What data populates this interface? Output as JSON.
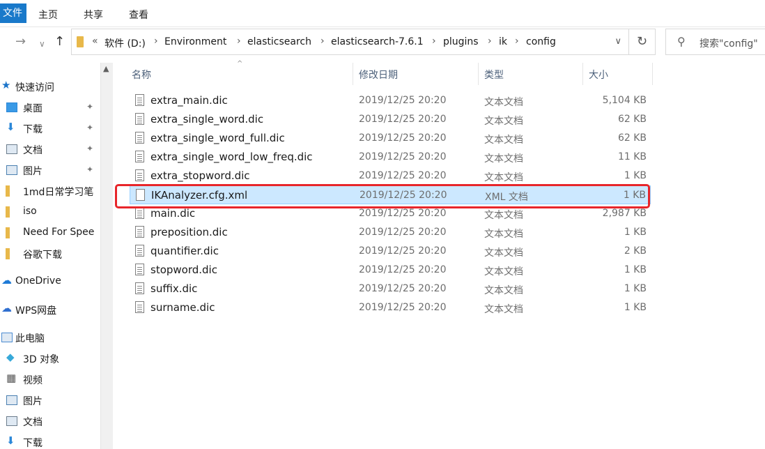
{
  "ribbon": {
    "file": "文件",
    "tabs": [
      "主页",
      "共享",
      "查看"
    ]
  },
  "address": {
    "crumbs": [
      "软件 (D:)",
      "Environment",
      "elasticsearch",
      "elasticsearch-7.6.1",
      "plugins",
      "ik",
      "config"
    ],
    "overflow": "«",
    "search_placeholder": "搜索\"config\""
  },
  "nav_pane": {
    "items": [
      {
        "label": "快速访问",
        "icon": "star-icon",
        "color": "#1a73c9"
      },
      {
        "label": "桌面",
        "icon": "desktop-icon",
        "color": "#2b87d8",
        "pinned": true
      },
      {
        "label": "下载",
        "icon": "download-arrow-icon",
        "color": "#2b87d8",
        "pinned": true
      },
      {
        "label": "文档",
        "icon": "document-icon",
        "color": "#6b7c8c",
        "pinned": true
      },
      {
        "label": "图片",
        "icon": "picture-icon",
        "color": "#4a7fb0",
        "pinned": true
      },
      {
        "label": "1md日常学习笔",
        "icon": "folder-icon",
        "color": "#e8b84a"
      },
      {
        "label": "iso",
        "icon": "folder-icon",
        "color": "#e8b84a"
      },
      {
        "label": "Need For Spee",
        "icon": "folder-icon",
        "color": "#e8b84a"
      },
      {
        "label": "谷歌下载",
        "icon": "folder-icon",
        "color": "#e8b84a"
      },
      {
        "label": "OneDrive",
        "icon": "cloud-icon",
        "color": "#1e7ad6"
      },
      {
        "label": "WPS网盘",
        "icon": "cloud-icon",
        "color": "#2f6fd0"
      },
      {
        "label": "此电脑",
        "icon": "computer-icon",
        "color": "#4b8bd1"
      },
      {
        "label": "3D 对象",
        "icon": "cube-icon",
        "color": "#37a9d9"
      },
      {
        "label": "视频",
        "icon": "film-icon",
        "color": "#555555"
      },
      {
        "label": "图片",
        "icon": "picture-icon",
        "color": "#4a7fb0"
      },
      {
        "label": "文档",
        "icon": "document-icon",
        "color": "#6b7c8c"
      },
      {
        "label": "下载",
        "icon": "download-arrow-icon",
        "color": "#2b87d8"
      }
    ]
  },
  "columns": {
    "name": "名称",
    "modified": "修改日期",
    "type": "类型",
    "size": "大小"
  },
  "files": [
    {
      "name": "extra_main.dic",
      "date": "2019/12/25 20:20",
      "type": "文本文档",
      "size": "5,104 KB"
    },
    {
      "name": "extra_single_word.dic",
      "date": "2019/12/25 20:20",
      "type": "文本文档",
      "size": "62 KB"
    },
    {
      "name": "extra_single_word_full.dic",
      "date": "2019/12/25 20:20",
      "type": "文本文档",
      "size": "62 KB"
    },
    {
      "name": "extra_single_word_low_freq.dic",
      "date": "2019/12/25 20:20",
      "type": "文本文档",
      "size": "11 KB"
    },
    {
      "name": "extra_stopword.dic",
      "date": "2019/12/25 20:20",
      "type": "文本文档",
      "size": "1 KB"
    },
    {
      "name": "IKAnalyzer.cfg.xml",
      "date": "2019/12/25 20:20",
      "type": "XML 文档",
      "size": "1 KB",
      "selected": true
    },
    {
      "name": "main.dic",
      "date": "2019/12/25 20:20",
      "type": "文本文档",
      "size": "2,987 KB"
    },
    {
      "name": "preposition.dic",
      "date": "2019/12/25 20:20",
      "type": "文本文档",
      "size": "1 KB"
    },
    {
      "name": "quantifier.dic",
      "date": "2019/12/25 20:20",
      "type": "文本文档",
      "size": "2 KB"
    },
    {
      "name": "stopword.dic",
      "date": "2019/12/25 20:20",
      "type": "文本文档",
      "size": "1 KB"
    },
    {
      "name": "suffix.dic",
      "date": "2019/12/25 20:20",
      "type": "文本文档",
      "size": "1 KB"
    },
    {
      "name": "surname.dic",
      "date": "2019/12/25 20:20",
      "type": "文本文档",
      "size": "1 KB"
    }
  ],
  "colors": {
    "accent": "#1979ca",
    "selection": "#cce8ff",
    "highlight_box": "#e8262b"
  }
}
